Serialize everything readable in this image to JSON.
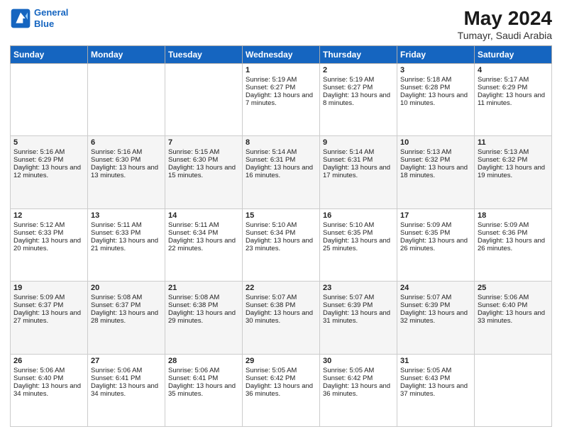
{
  "logo": {
    "line1": "General",
    "line2": "Blue"
  },
  "title": "May 2024",
  "subtitle": "Tumayr, Saudi Arabia",
  "days_header": [
    "Sunday",
    "Monday",
    "Tuesday",
    "Wednesday",
    "Thursday",
    "Friday",
    "Saturday"
  ],
  "weeks": [
    [
      {
        "day": "",
        "info": ""
      },
      {
        "day": "",
        "info": ""
      },
      {
        "day": "",
        "info": ""
      },
      {
        "day": "1",
        "info": "Sunrise: 5:19 AM\nSunset: 6:27 PM\nDaylight: 13 hours and 7 minutes."
      },
      {
        "day": "2",
        "info": "Sunrise: 5:19 AM\nSunset: 6:27 PM\nDaylight: 13 hours and 8 minutes."
      },
      {
        "day": "3",
        "info": "Sunrise: 5:18 AM\nSunset: 6:28 PM\nDaylight: 13 hours and 10 minutes."
      },
      {
        "day": "4",
        "info": "Sunrise: 5:17 AM\nSunset: 6:29 PM\nDaylight: 13 hours and 11 minutes."
      }
    ],
    [
      {
        "day": "5",
        "info": "Sunrise: 5:16 AM\nSunset: 6:29 PM\nDaylight: 13 hours and 12 minutes."
      },
      {
        "day": "6",
        "info": "Sunrise: 5:16 AM\nSunset: 6:30 PM\nDaylight: 13 hours and 13 minutes."
      },
      {
        "day": "7",
        "info": "Sunrise: 5:15 AM\nSunset: 6:30 PM\nDaylight: 13 hours and 15 minutes."
      },
      {
        "day": "8",
        "info": "Sunrise: 5:14 AM\nSunset: 6:31 PM\nDaylight: 13 hours and 16 minutes."
      },
      {
        "day": "9",
        "info": "Sunrise: 5:14 AM\nSunset: 6:31 PM\nDaylight: 13 hours and 17 minutes."
      },
      {
        "day": "10",
        "info": "Sunrise: 5:13 AM\nSunset: 6:32 PM\nDaylight: 13 hours and 18 minutes."
      },
      {
        "day": "11",
        "info": "Sunrise: 5:13 AM\nSunset: 6:32 PM\nDaylight: 13 hours and 19 minutes."
      }
    ],
    [
      {
        "day": "12",
        "info": "Sunrise: 5:12 AM\nSunset: 6:33 PM\nDaylight: 13 hours and 20 minutes."
      },
      {
        "day": "13",
        "info": "Sunrise: 5:11 AM\nSunset: 6:33 PM\nDaylight: 13 hours and 21 minutes."
      },
      {
        "day": "14",
        "info": "Sunrise: 5:11 AM\nSunset: 6:34 PM\nDaylight: 13 hours and 22 minutes."
      },
      {
        "day": "15",
        "info": "Sunrise: 5:10 AM\nSunset: 6:34 PM\nDaylight: 13 hours and 23 minutes."
      },
      {
        "day": "16",
        "info": "Sunrise: 5:10 AM\nSunset: 6:35 PM\nDaylight: 13 hours and 25 minutes."
      },
      {
        "day": "17",
        "info": "Sunrise: 5:09 AM\nSunset: 6:35 PM\nDaylight: 13 hours and 26 minutes."
      },
      {
        "day": "18",
        "info": "Sunrise: 5:09 AM\nSunset: 6:36 PM\nDaylight: 13 hours and 26 minutes."
      }
    ],
    [
      {
        "day": "19",
        "info": "Sunrise: 5:09 AM\nSunset: 6:37 PM\nDaylight: 13 hours and 27 minutes."
      },
      {
        "day": "20",
        "info": "Sunrise: 5:08 AM\nSunset: 6:37 PM\nDaylight: 13 hours and 28 minutes."
      },
      {
        "day": "21",
        "info": "Sunrise: 5:08 AM\nSunset: 6:38 PM\nDaylight: 13 hours and 29 minutes."
      },
      {
        "day": "22",
        "info": "Sunrise: 5:07 AM\nSunset: 6:38 PM\nDaylight: 13 hours and 30 minutes."
      },
      {
        "day": "23",
        "info": "Sunrise: 5:07 AM\nSunset: 6:39 PM\nDaylight: 13 hours and 31 minutes."
      },
      {
        "day": "24",
        "info": "Sunrise: 5:07 AM\nSunset: 6:39 PM\nDaylight: 13 hours and 32 minutes."
      },
      {
        "day": "25",
        "info": "Sunrise: 5:06 AM\nSunset: 6:40 PM\nDaylight: 13 hours and 33 minutes."
      }
    ],
    [
      {
        "day": "26",
        "info": "Sunrise: 5:06 AM\nSunset: 6:40 PM\nDaylight: 13 hours and 34 minutes."
      },
      {
        "day": "27",
        "info": "Sunrise: 5:06 AM\nSunset: 6:41 PM\nDaylight: 13 hours and 34 minutes."
      },
      {
        "day": "28",
        "info": "Sunrise: 5:06 AM\nSunset: 6:41 PM\nDaylight: 13 hours and 35 minutes."
      },
      {
        "day": "29",
        "info": "Sunrise: 5:05 AM\nSunset: 6:42 PM\nDaylight: 13 hours and 36 minutes."
      },
      {
        "day": "30",
        "info": "Sunrise: 5:05 AM\nSunset: 6:42 PM\nDaylight: 13 hours and 36 minutes."
      },
      {
        "day": "31",
        "info": "Sunrise: 5:05 AM\nSunset: 6:43 PM\nDaylight: 13 hours and 37 minutes."
      },
      {
        "day": "",
        "info": ""
      }
    ]
  ]
}
